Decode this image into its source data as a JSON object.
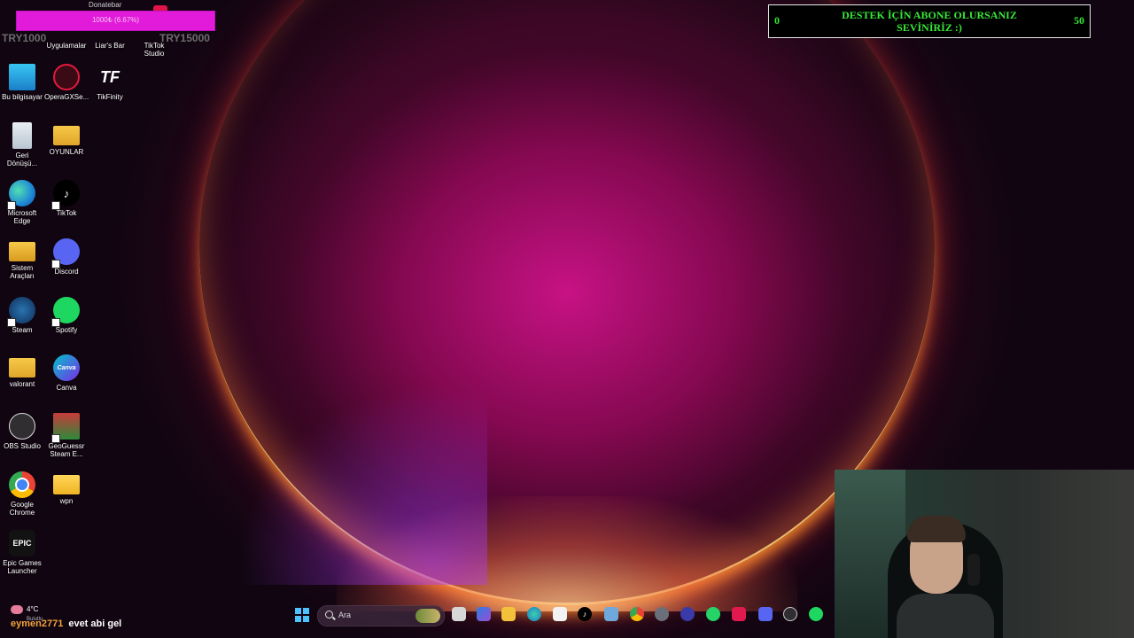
{
  "donation": {
    "title": "Donatebar",
    "progress_text": "1000₺ (6.67%)",
    "current": "TRY1000",
    "goal": "TRY15000",
    "progress_fraction": 0.0667
  },
  "support_box": {
    "min": "0",
    "max": "50",
    "text_line1": "DESTEK İÇİN ABONE OLURSANIZ",
    "text_line2": "SEVİNİRİZ :)"
  },
  "desktop_icons": [
    {
      "label_line1": "Uygulamalar",
      "label_line2": ""
    },
    {
      "label_line1": "Liar's Bar",
      "label_line2": ""
    },
    {
      "label_line1": "TikTok",
      "label_line2": "Studio"
    },
    {
      "label_line1": "Bu bilgisayar",
      "label_line2": ""
    },
    {
      "label_line1": "OperaGXSe...",
      "label_line2": ""
    },
    {
      "label_line1": "TikFinity",
      "label_line2": ""
    },
    {
      "label_line1": "Geri",
      "label_line2": "Dönüşü..."
    },
    {
      "label_line1": "OYUNLAR",
      "label_line2": ""
    },
    {
      "label_line1": "Microsoft",
      "label_line2": "Edge"
    },
    {
      "label_line1": "TikTok",
      "label_line2": ""
    },
    {
      "label_line1": "Sistem",
      "label_line2": "Araçları"
    },
    {
      "label_line1": "Discord",
      "label_line2": ""
    },
    {
      "label_line1": "Steam",
      "label_line2": ""
    },
    {
      "label_line1": "Spotify",
      "label_line2": ""
    },
    {
      "label_line1": "valorant",
      "label_line2": ""
    },
    {
      "label_line1": "Canva",
      "label_line2": ""
    },
    {
      "label_line1": "OBS Studio",
      "label_line2": ""
    },
    {
      "label_line1": "GeoGuessr",
      "label_line2": "Steam E..."
    },
    {
      "label_line1": "Google",
      "label_line2": "Chrome"
    },
    {
      "label_line1": "wpn",
      "label_line2": ""
    },
    {
      "label_line1": "Epic Games",
      "label_line2": "Launcher"
    }
  ],
  "icon_glyphs": {
    "tikfinity": "TF",
    "epic": "EPIC",
    "canva": "Canva"
  },
  "taskbar": {
    "weather_temp": "4°C",
    "weather_desc": "Bulutlu",
    "search_placeholder": "Ara"
  },
  "chat": {
    "user": "eymen2771",
    "message": "evet abi gel"
  },
  "colors": {
    "support_text": "#38e838",
    "donate_bar": "#e21ad9",
    "chat_user": "#f2a33a"
  }
}
